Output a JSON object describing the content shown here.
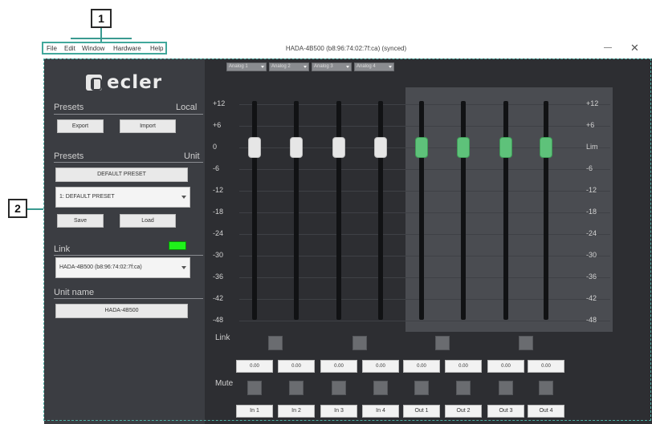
{
  "callouts": [
    "1",
    "2"
  ],
  "menu": [
    "File",
    "Edit",
    "Window",
    "Hardware",
    "Help"
  ],
  "window": {
    "title": "HADA-4B500 (b8:96:74:02:7f:ca) (synced)",
    "minimize": "—",
    "close": "✕"
  },
  "logo": {
    "text": "ecler",
    "icon": "ecler-logo-icon"
  },
  "sidebar": {
    "presets_local": {
      "label": "Presets",
      "scope": "Local",
      "export_label": "Export",
      "import_label": "Import"
    },
    "presets_unit": {
      "label": "Presets",
      "scope": "Unit",
      "current_preset": "DEFAULT PRESET",
      "preset_select": "1: DEFAULT PRESET",
      "save_label": "Save",
      "load_label": "Load"
    },
    "link": {
      "label": "Link",
      "device_select": "HADA-4B500 (b8:96:74:02:7f:ca)",
      "status_color": "#1ff21a"
    },
    "unit_name": {
      "label": "Unit name",
      "value": "HADA-4B500"
    }
  },
  "mixer": {
    "tabs": [
      "Analog 1",
      "Analog 2",
      "Analog 3",
      "Analog 4"
    ],
    "scale_left": [
      "+12",
      "+6",
      "0",
      "-6",
      "-12",
      "-18",
      "-24",
      "-30",
      "-36",
      "-42",
      "-48"
    ],
    "scale_right": [
      "+12",
      "+6",
      "Lim",
      "-6",
      "-12",
      "-18",
      "-24",
      "-30",
      "-36",
      "-42",
      "-48"
    ],
    "link_label": "Link",
    "mute_label": "Mute",
    "channels": [
      {
        "name": "In 1",
        "value": "0.00",
        "type": "input",
        "level_db": 0
      },
      {
        "name": "In 2",
        "value": "0.00",
        "type": "input",
        "level_db": 0
      },
      {
        "name": "In 3",
        "value": "0.00",
        "type": "input",
        "level_db": 0
      },
      {
        "name": "In 4",
        "value": "0.00",
        "type": "input",
        "level_db": 0
      },
      {
        "name": "Out 1",
        "value": "0.00",
        "type": "output",
        "level_db": 0
      },
      {
        "name": "Out 2",
        "value": "0.00",
        "type": "output",
        "level_db": 0
      },
      {
        "name": "Out 3",
        "value": "0.00",
        "type": "output",
        "level_db": 0
      },
      {
        "name": "Out 4",
        "value": "0.00",
        "type": "output",
        "level_db": 0
      }
    ],
    "colors": {
      "input_fader": "#e6e6e6",
      "output_fader": "#5ec27a"
    }
  }
}
